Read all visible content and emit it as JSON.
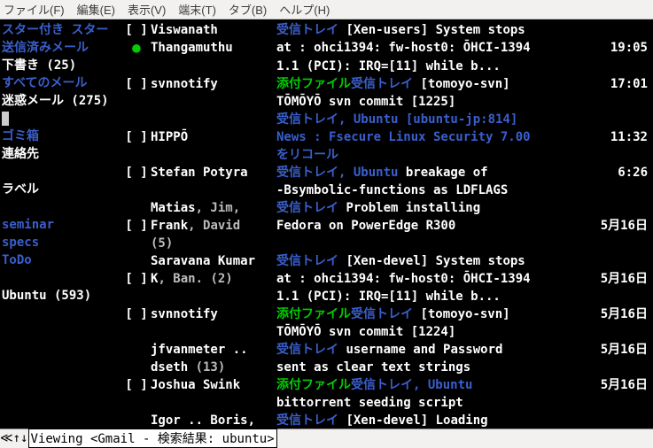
{
  "menubar": {
    "file": "ファイル(F)",
    "edit": "編集(E)",
    "view": "表示(V)",
    "terminal": "端末(T)",
    "tabs": "タブ(B)",
    "help": "ヘルプ(H)"
  },
  "sidebar": {
    "starred": "スター付き スター",
    "sent": "送信済みメール",
    "drafts": "下書き (25)",
    "allmail": "すべてのメール",
    "spam": "迷惑メール (275)",
    "trash": "ゴミ箱",
    "contacts": "連絡先",
    "labels": "ラベル",
    "seminar": "seminar",
    "specs": "specs",
    "todo": "ToDo",
    "ubuntu": "Ubuntu (593)"
  },
  "rows": [
    {
      "mark": "[ ]",
      "dot": false,
      "sender_parts": [
        {
          "t": "Viswanath",
          "c": "c-white"
        }
      ],
      "body_parts": [
        {
          "t": "受信トレイ ",
          "c": "c-blue"
        },
        {
          "t": "[Xen-users] System stops",
          "c": "c-white"
        }
      ],
      "date": ""
    },
    {
      "mark": "",
      "dot": true,
      "sender_parts": [
        {
          "t": "Thangamuthu",
          "c": "c-white"
        }
      ],
      "body_parts": [
        {
          "t": "at : ohci1394: fw-host0: ŌHCI-1394",
          "c": "c-white"
        }
      ],
      "date": "19:05"
    },
    {
      "mark": "",
      "dot": false,
      "sender_parts": [],
      "body_parts": [
        {
          "t": "1.1 (PCI): IRQ=[11] while b...",
          "c": "c-white"
        }
      ],
      "date": ""
    },
    {
      "mark": "[ ]",
      "dot": false,
      "sender_parts": [
        {
          "t": "svnnotify",
          "c": "c-white"
        }
      ],
      "body_parts": [
        {
          "t": "添付ファイル",
          "c": "c-green"
        },
        {
          "t": "受信トレイ ",
          "c": "c-blue"
        },
        {
          "t": "[tomoyo-svn]",
          "c": "c-white"
        }
      ],
      "date": "17:01"
    },
    {
      "mark": "",
      "dot": false,
      "sender_parts": [],
      "body_parts": [
        {
          "t": "TŌMŌYŌ svn commit [1225]",
          "c": "c-white"
        }
      ],
      "date": ""
    },
    {
      "mark": "",
      "dot": false,
      "sender_parts": [],
      "body_parts": [
        {
          "t": "受信トレイ, Ubuntu [ubuntu-jp:814]",
          "c": "c-blue"
        }
      ],
      "date": ""
    },
    {
      "mark": "[ ]",
      "dot": false,
      "sender_parts": [
        {
          "t": "HIPPŌ",
          "c": "c-white"
        }
      ],
      "body_parts": [
        {
          "t": "News : Fsecure Linux Security 7.00",
          "c": "c-blue"
        }
      ],
      "date": "11:32"
    },
    {
      "mark": "",
      "dot": false,
      "sender_parts": [],
      "body_parts": [
        {
          "t": "をリコール",
          "c": "c-blue"
        }
      ],
      "date": ""
    },
    {
      "mark": "[ ]",
      "dot": false,
      "sender_parts": [
        {
          "t": "Stefan Potyra",
          "c": "c-white"
        }
      ],
      "body_parts": [
        {
          "t": "受信トレイ, Ubuntu ",
          "c": "c-blue"
        },
        {
          "t": "breakage of",
          "c": "c-white"
        }
      ],
      "date": "6:26"
    },
    {
      "mark": "",
      "dot": false,
      "sender_parts": [],
      "body_parts": [
        {
          "t": "-Bsymbolic-functions as LDFLAGS",
          "c": "c-white"
        }
      ],
      "date": ""
    },
    {
      "mark": "",
      "dot": false,
      "sender_parts": [
        {
          "t": "Matias",
          "c": "c-white"
        },
        {
          "t": ", Jim,",
          "c": "c-grey"
        }
      ],
      "body_parts": [
        {
          "t": "受信トレイ ",
          "c": "c-blue"
        },
        {
          "t": "Problem installing",
          "c": "c-white"
        }
      ],
      "date": ""
    },
    {
      "mark": "[ ]",
      "dot": false,
      "sender_parts": [
        {
          "t": "Frank",
          "c": "c-white"
        },
        {
          "t": ", David",
          "c": "c-grey"
        }
      ],
      "body_parts": [
        {
          "t": "Fedora on PowerEdge R300",
          "c": "c-white"
        }
      ],
      "date": "5月16日"
    },
    {
      "mark": "",
      "dot": false,
      "sender_parts": [
        {
          "t": " (5)",
          "c": "c-grey"
        }
      ],
      "body_parts": [],
      "date": ""
    },
    {
      "mark": "",
      "dot": false,
      "sender_parts": [
        {
          "t": "Saravana Kumar",
          "c": "c-white"
        }
      ],
      "body_parts": [
        {
          "t": "受信トレイ ",
          "c": "c-blue"
        },
        {
          "t": "[Xen-devel] System stops",
          "c": "c-white"
        }
      ],
      "date": ""
    },
    {
      "mark": "[ ]",
      "dot": false,
      "sender_parts": [
        {
          "t": "K",
          "c": "c-white"
        },
        {
          "t": ", Ban. (2)",
          "c": "c-grey"
        }
      ],
      "body_parts": [
        {
          "t": "at : ohci1394: fw-host0: ŌHCI-1394",
          "c": "c-white"
        }
      ],
      "date": "5月16日"
    },
    {
      "mark": "",
      "dot": false,
      "sender_parts": [],
      "body_parts": [
        {
          "t": "1.1 (PCI): IRQ=[11] while b...",
          "c": "c-white"
        }
      ],
      "date": ""
    },
    {
      "mark": "[ ]",
      "dot": false,
      "sender_parts": [
        {
          "t": "svnnotify",
          "c": "c-white"
        }
      ],
      "body_parts": [
        {
          "t": "添付ファイル",
          "c": "c-green"
        },
        {
          "t": "受信トレイ ",
          "c": "c-blue"
        },
        {
          "t": "[tomoyo-svn]",
          "c": "c-white"
        }
      ],
      "date": "5月16日"
    },
    {
      "mark": "",
      "dot": false,
      "sender_parts": [],
      "body_parts": [
        {
          "t": "TŌMŌYŌ svn commit [1224]",
          "c": "c-white"
        }
      ],
      "date": ""
    },
    {
      "mark": "",
      "dot": false,
      "sender_parts": [
        {
          "t": "jfvanmeter ..",
          "c": "c-white"
        }
      ],
      "body_parts": [
        {
          "t": "受信トレイ ",
          "c": "c-blue"
        },
        {
          "t": "username and Password",
          "c": "c-white"
        }
      ],
      "date": "5月16日"
    },
    {
      "mark": "",
      "dot": false,
      "sender_parts": [
        {
          "t": "dseth ",
          "c": "c-white"
        },
        {
          "t": "(13)",
          "c": "c-grey"
        }
      ],
      "body_parts": [
        {
          "t": "sent as clear text strings",
          "c": "c-white"
        }
      ],
      "date": ""
    },
    {
      "mark": "[ ]",
      "dot": false,
      "sender_parts": [
        {
          "t": "Joshua Swink",
          "c": "c-white"
        }
      ],
      "body_parts": [
        {
          "t": "添付ファイル",
          "c": "c-green"
        },
        {
          "t": "受信トレイ, Ubuntu",
          "c": "c-blue"
        }
      ],
      "date": "5月16日"
    },
    {
      "mark": "",
      "dot": false,
      "sender_parts": [],
      "body_parts": [
        {
          "t": "bittorrent seeding script",
          "c": "c-white"
        }
      ],
      "date": ""
    },
    {
      "mark": "",
      "dot": false,
      "sender_parts": [
        {
          "t": "Igor .. Boris,",
          "c": "c-white"
        }
      ],
      "body_parts": [
        {
          "t": "受信トレイ ",
          "c": "c-blue"
        },
        {
          "t": "[Xen-devel] Loading",
          "c": "c-white"
        }
      ],
      "date": ""
    }
  ],
  "statusbar": {
    "arrows": "≪↑↓",
    "text": "Viewing <Gmail - 検索結果: ubuntu>"
  }
}
